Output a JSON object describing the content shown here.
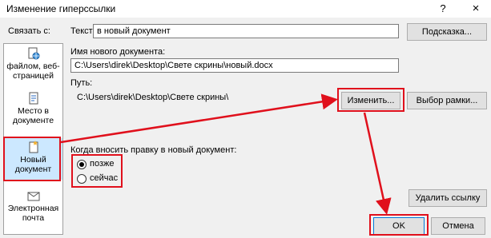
{
  "window": {
    "title": "Изменение гиперссылки",
    "help_label": "?",
    "close_label": "×"
  },
  "sidebar": {
    "header": "Связать с:",
    "items": [
      {
        "label_line1": "файлом, веб-",
        "label_line2": "страницей",
        "icon": "globe-file-icon"
      },
      {
        "label_line1": "Место в",
        "label_line2": "документе",
        "icon": "document-place-icon"
      },
      {
        "label_line1": "Новый",
        "label_line2": "документ",
        "icon": "new-document-icon",
        "selected": true
      },
      {
        "label_line1": "Электронная",
        "label_line2": "почта",
        "icon": "email-icon"
      }
    ]
  },
  "text_field": {
    "label": "Текст:",
    "value": "в новый документ"
  },
  "tooltip_button": {
    "label": "Подсказка..."
  },
  "new_doc": {
    "label": "Имя нового документа:",
    "value": "C:\\Users\\direk\\Desktop\\Свете скрины\\новый.docx"
  },
  "path": {
    "label": "Путь:",
    "value": "C:\\Users\\direk\\Desktop\\Свете скрины\\"
  },
  "change_button": {
    "label": "Изменить..."
  },
  "frame_button": {
    "label": "Выбор рамки..."
  },
  "edit_when": {
    "label": "Когда вносить правку в новый документ:",
    "options": [
      {
        "label": "позже",
        "checked": true
      },
      {
        "label": "сейчас",
        "checked": false
      }
    ]
  },
  "remove_link_button": {
    "label": "Удалить ссылку"
  },
  "ok_button": {
    "label": "OK"
  },
  "cancel_button": {
    "label": "Отмена"
  },
  "colors": {
    "annotation_red": "#e0101c",
    "selection_blue": "#cce8ff"
  }
}
